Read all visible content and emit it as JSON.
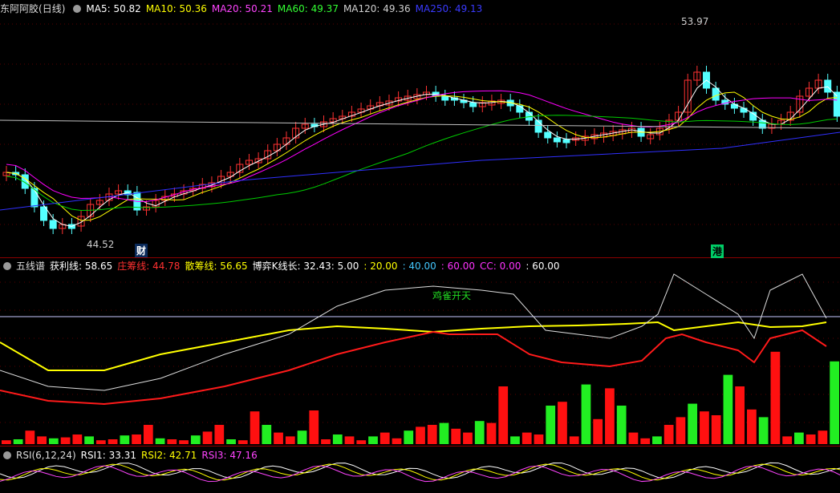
{
  "main": {
    "stock_name": "东阿阿胶",
    "period": "(日线)",
    "ma": [
      {
        "label": "MA5: 50.82",
        "color": "#ffffff"
      },
      {
        "label": "MA10: 50.36",
        "color": "#ffff00"
      },
      {
        "label": "MA20: 50.21",
        "color": "#ff00ff"
      },
      {
        "label": "MA60: 49.37",
        "color": "#00ff00"
      },
      {
        "label": "MA120: 49.36",
        "color": "#c0c0c0"
      },
      {
        "label": "MA250: 49.13",
        "color": "#3030ff"
      }
    ],
    "high_label": "53.97",
    "low_label": "44.52",
    "cai_mark": "财",
    "gang_mark": "港"
  },
  "wuxian": {
    "title": "五线谱",
    "profit": "获利线: 58.65",
    "zhuang": "庄筹线: 44.78",
    "san": "散筹线: 56.65",
    "boyi": "博弈K线长: 32.43",
    "p5": ": 5.00",
    "p20": ": 20.00",
    "p40": ": 40.00",
    "p60": ": 60.00",
    "cc": "CC: 0.00",
    "p60b": ": 60.00",
    "note": "鸡雀开天"
  },
  "rsi": {
    "title": "RSI(6,12,24)",
    "rsi1": "RSI1: 33.31",
    "rsi2": "RSI2: 42.71",
    "rsi3": "RSI3: 47.16"
  },
  "colors": {
    "up": "#ff3232",
    "down": "#54ffff",
    "bg": "#000000",
    "grid": "#8b0000"
  }
}
